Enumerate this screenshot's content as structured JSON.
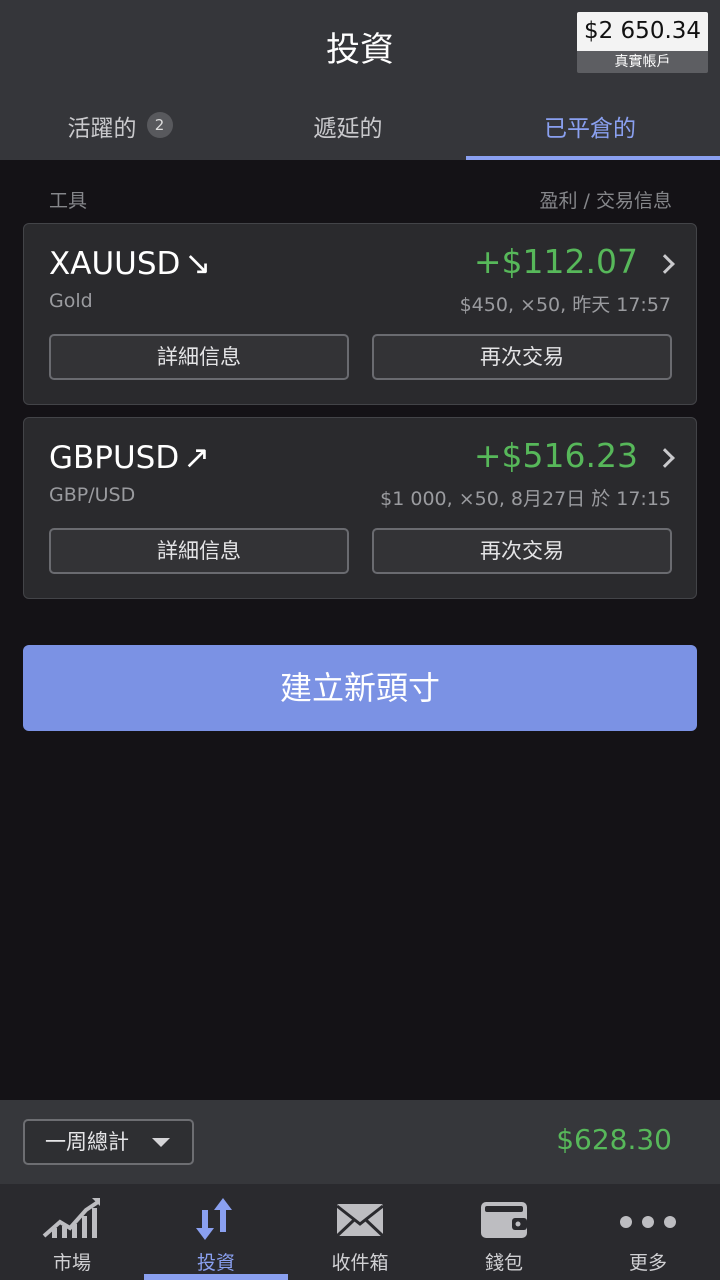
{
  "header": {
    "title": "投資",
    "balance": {
      "amount": "$2 650.34",
      "label": "真實帳戶"
    }
  },
  "tabs": [
    {
      "label": "活躍的",
      "badge": "2",
      "active": false
    },
    {
      "label": "遞延的",
      "active": false
    },
    {
      "label": "已平倉的",
      "active": true
    }
  ],
  "columns": {
    "left": "工具",
    "right": "盈利 / 交易信息"
  },
  "trades": [
    {
      "symbol": "XAUUSD",
      "arrow": "↘",
      "name": "Gold",
      "profit": "+$112.07",
      "info": "$450, ×50, 昨天 17:57",
      "details_label": "詳細信息",
      "trade_again_label": "再次交易"
    },
    {
      "symbol": "GBPUSD",
      "arrow": "↗",
      "name": "GBP/USD",
      "profit": "+$516.23",
      "info": "$1 000, ×50, 8月27日 於 17:15",
      "details_label": "詳細信息",
      "trade_again_label": "再次交易"
    }
  ],
  "cta": {
    "label": "建立新頭寸"
  },
  "summary": {
    "period": "一周總計",
    "total": "$628.30"
  },
  "nav": [
    {
      "label": "市場",
      "icon": "chart-growth-icon",
      "active": false
    },
    {
      "label": "投資",
      "icon": "up-down-arrows-icon",
      "active": true
    },
    {
      "label": "收件箱",
      "icon": "envelope-icon",
      "active": false
    },
    {
      "label": "錢包",
      "icon": "wallet-icon",
      "active": false
    },
    {
      "label": "更多",
      "icon": "more-dots-icon",
      "active": false
    }
  ],
  "colors": {
    "accent": "#8aa0f0",
    "profit": "#57b85a",
    "cta": "#7b92e4"
  }
}
